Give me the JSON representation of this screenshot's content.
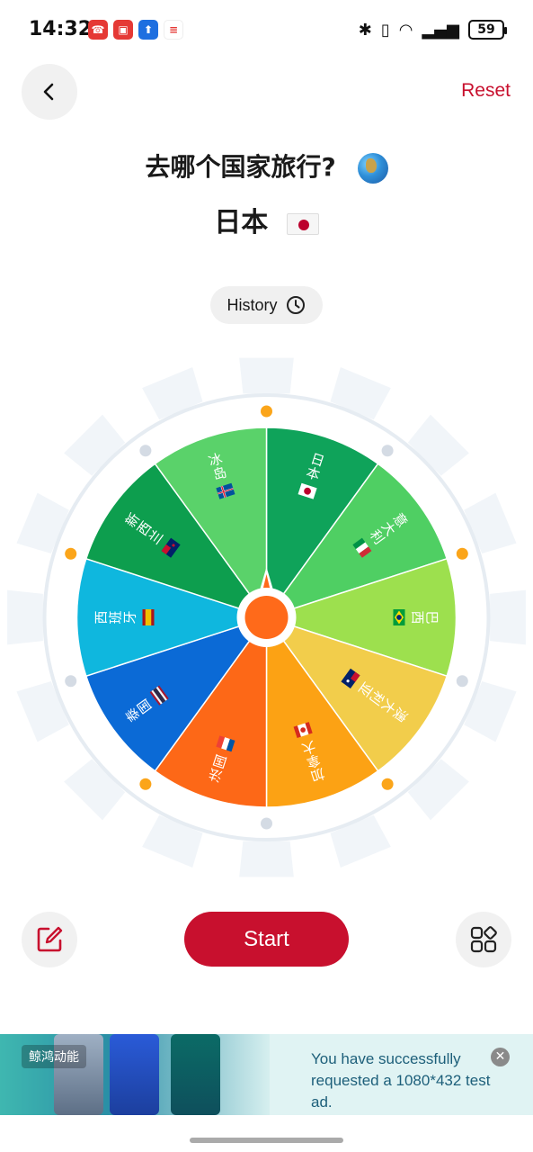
{
  "status_bar": {
    "time": "14:32",
    "battery": "59",
    "notification_icons": [
      "phone-icon",
      "gallery-icon",
      "app-store-icon",
      "calendar-icon"
    ]
  },
  "header": {
    "reset_label": "Reset"
  },
  "question": {
    "title": "去哪个国家旅行?",
    "result": "日本"
  },
  "history_label": "History",
  "wheel": {
    "segments": [
      {
        "label": "日本",
        "flag": "jp",
        "color": "#0fa35a"
      },
      {
        "label": "意大利",
        "flag": "it",
        "color": "#4fcf63"
      },
      {
        "label": "巴西",
        "flag": "br",
        "color": "#9de04e"
      },
      {
        "label": "澳大利亚",
        "flag": "au",
        "color": "#f2cd4b"
      },
      {
        "label": "加拿大",
        "flag": "ca",
        "color": "#fca214"
      },
      {
        "label": "法国",
        "flag": "fr",
        "color": "#fd6817"
      },
      {
        "label": "泰国",
        "flag": "th",
        "color": "#0b6ad6"
      },
      {
        "label": "西班牙",
        "flag": "es",
        "color": "#0fb7de"
      },
      {
        "label": "新西兰",
        "flag": "nz",
        "color": "#0d9e4e"
      },
      {
        "label": "冰岛",
        "flag": "is",
        "color": "#5ad26a"
      }
    ],
    "pointer_color": "#ff6a1a"
  },
  "start_label": "Start",
  "ad": {
    "badge": "鲸鸿动能",
    "message": "You have successfully requested a 1080*432 test ad."
  },
  "colors": {
    "accent": "#c8102e"
  }
}
